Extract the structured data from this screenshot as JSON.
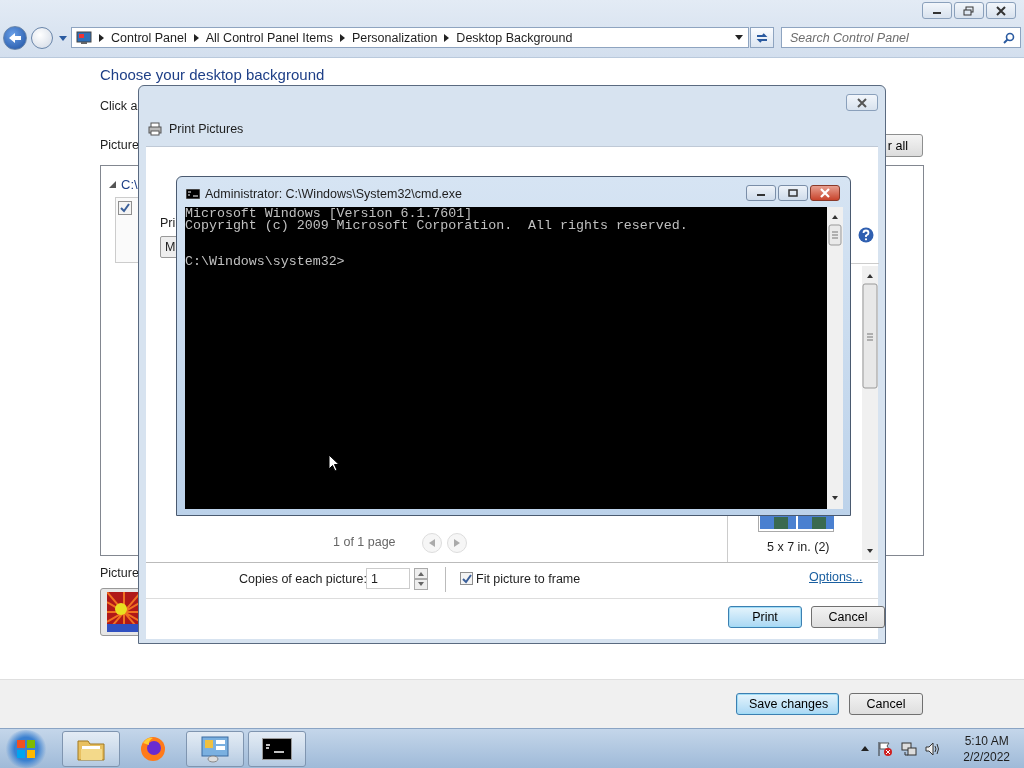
{
  "explorer": {
    "breadcrumbs": [
      "Control Panel",
      "All Control Panel Items",
      "Personalization",
      "Desktop Background"
    ],
    "search": {
      "placeholder": "Search Control Panel"
    },
    "heading": "Choose your desktop background",
    "intro": "Click a",
    "location_label": "Picture",
    "clear_button": "r all",
    "group": {
      "label": "C:\\",
      "expanded": true
    },
    "thumbnail": {
      "checked": true
    },
    "position_label": "Picture",
    "buttons": [
      {
        "label": "Save changes",
        "default": true
      },
      {
        "label": "Cancel",
        "default": false
      }
    ]
  },
  "print_dialog": {
    "title": "Print Pictures",
    "printer_label": "Pri",
    "printer_value": "M",
    "page_info": "1 of 1 page",
    "size_option": "5 x 7 in. (2)",
    "copies_label": "Copies of each picture:",
    "copies": "1",
    "fit": {
      "label": "Fit picture to frame",
      "checked": true
    },
    "options_link": "Options...",
    "buttons": [
      {
        "label": "Print",
        "default": true
      },
      {
        "label": "Cancel",
        "default": false
      }
    ]
  },
  "console": {
    "title": "Administrator: C:\\Windows\\System32\\cmd.exe",
    "lines": [
      "Microsoft Windows [Version 6.1.7601]",
      "Copyright (c) 2009 Microsoft Corporation.  All rights reserved."
    ],
    "prompt": "C:\\Windows\\system32>"
  },
  "taskbar": {
    "apps": [
      {
        "kind": "folder",
        "running": true
      },
      {
        "kind": "browser",
        "running": false
      },
      {
        "kind": "control-panel",
        "running": true
      },
      {
        "kind": "console",
        "running": true
      }
    ],
    "time": "5:10 AM",
    "date": "2/2/2022"
  }
}
